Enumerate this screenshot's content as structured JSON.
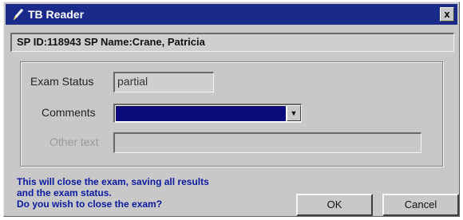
{
  "window": {
    "title": "TB Reader",
    "close_glyph": "x"
  },
  "id_bar": {
    "text": "SP ID:118943 SP Name:Crane, Patricia"
  },
  "form": {
    "exam_status_label": "Exam Status",
    "exam_status_value": "partial",
    "comments_label": "Comments",
    "comments_value": "",
    "other_text_label": "Other text",
    "other_text_value": ""
  },
  "message": {
    "line1": "This will close the exam, saving all results",
    "line2": "and the exam status.",
    "line3": "Do you wish to close the exam?"
  },
  "buttons": {
    "ok": "OK",
    "cancel": "Cancel"
  },
  "colors": {
    "titlebar": "#1a2a8a",
    "message_text": "#0a1aa0",
    "combo_selection": "#0a0a7a"
  }
}
